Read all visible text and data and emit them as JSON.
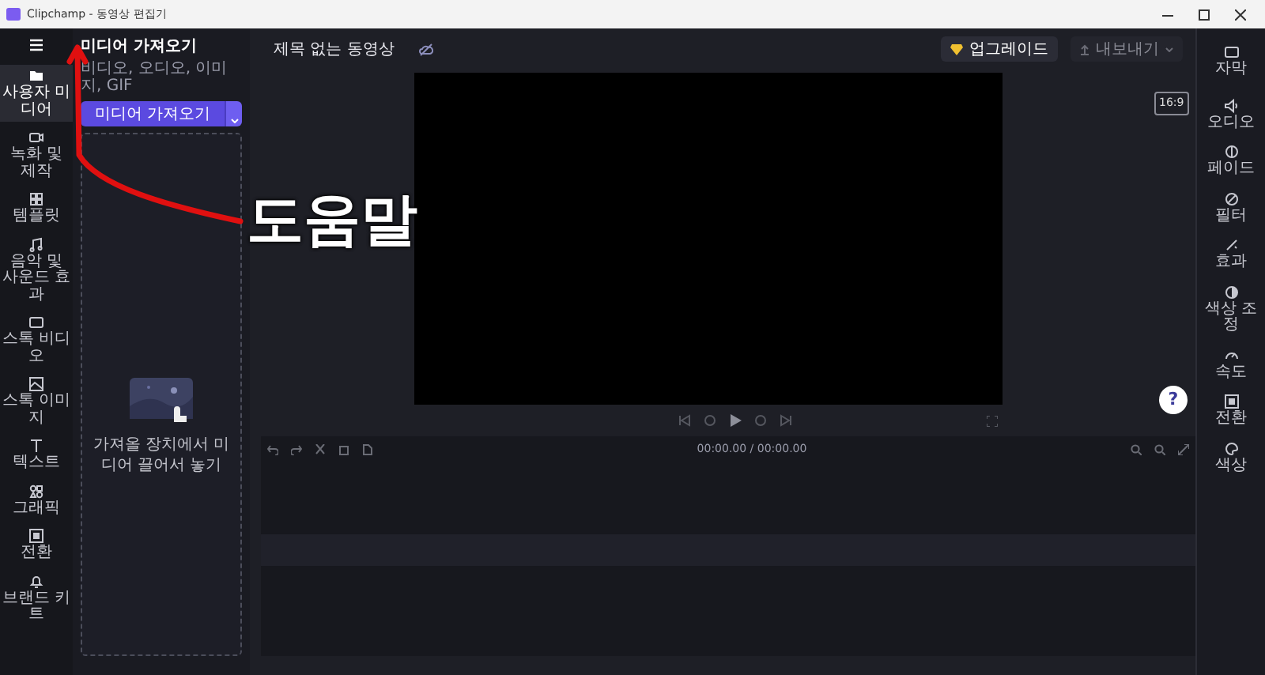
{
  "window": {
    "title": "Clipchamp - 동영상 편집기"
  },
  "left_rail": [
    {
      "label": "사용자 미디어",
      "selected": true
    },
    {
      "label": "녹화 및 제작",
      "selected": false
    },
    {
      "label": "템플릿",
      "selected": false
    },
    {
      "label": "음악 및 사운드 효과",
      "selected": false
    },
    {
      "label": "스톡 비디오",
      "selected": false
    },
    {
      "label": "스톡 이미지",
      "selected": false
    },
    {
      "label": "텍스트",
      "selected": false
    },
    {
      "label": "그래픽",
      "selected": false
    },
    {
      "label": "전환",
      "selected": false
    },
    {
      "label": "브랜드 키트",
      "selected": false
    }
  ],
  "media_panel": {
    "title": "미디어 가져오기",
    "subtitle": "비디오, 오디오, 이미지, GIF",
    "import_button": "미디어 가져오기",
    "drop_hint": "가져올 장치에서 미디어 끌어서 놓기"
  },
  "header": {
    "project_title": "제목 없는 동영상",
    "upgrade": "업그레이드",
    "export": {
      "label": "내보내기",
      "disabled": true
    },
    "aspect": "16:9"
  },
  "timeline": {
    "time": "00:00.00 / 00:00.00"
  },
  "right_rail": [
    {
      "label": "자막"
    },
    {
      "label": "오디오"
    },
    {
      "label": "페이드"
    },
    {
      "label": "필터"
    },
    {
      "label": "효과"
    },
    {
      "label": "색상 조정"
    },
    {
      "label": "속도"
    },
    {
      "label": "전환"
    },
    {
      "label": "색상"
    }
  ],
  "help": "?",
  "annotation": {
    "label": "도움말"
  }
}
